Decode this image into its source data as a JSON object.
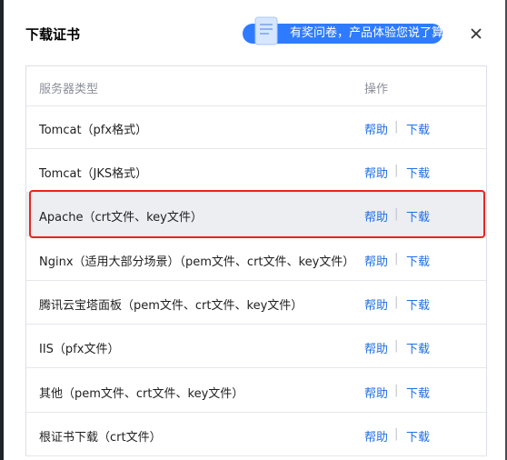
{
  "dialog": {
    "title": "下载证书",
    "survey_label": "有奖问卷，产品体验您说了算"
  },
  "table": {
    "headers": {
      "type": "服务器类型",
      "operation": "操作"
    },
    "rows": [
      {
        "name": "Tomcat（pfx格式）",
        "help": "帮助",
        "sep": "|",
        "download": "下载"
      },
      {
        "name": "Tomcat（JKS格式）",
        "help": "帮助",
        "sep": "|",
        "download": "下载"
      },
      {
        "name": "Apache（crt文件、key文件）",
        "help": "帮助",
        "sep": "|",
        "download": "下载"
      },
      {
        "name": "Nginx（适用大部分场景）（pem文件、crt文件、key文件）",
        "help": "帮助",
        "sep": "|",
        "download": "下载"
      },
      {
        "name": "腾讯云宝塔面板（pem文件、crt文件、key文件）",
        "help": "帮助",
        "sep": "|",
        "download": "下载"
      },
      {
        "name": "IIS（pfx文件）",
        "help": "帮助",
        "sep": "|",
        "download": "下载"
      },
      {
        "name": "其他（pem文件、crt文件、key文件）",
        "help": "帮助",
        "sep": "|",
        "download": "下载"
      },
      {
        "name": "根证书下载（crt文件）",
        "help": "帮助",
        "sep": "|",
        "download": "下载"
      }
    ]
  },
  "icons": {
    "close": "close-icon",
    "survey": "document-icon"
  },
  "colors": {
    "link": "#1f6fe5",
    "survey_bg": "#2f7bff",
    "highlight_row": "#eceef2",
    "highlight_border": "#e8261d"
  }
}
